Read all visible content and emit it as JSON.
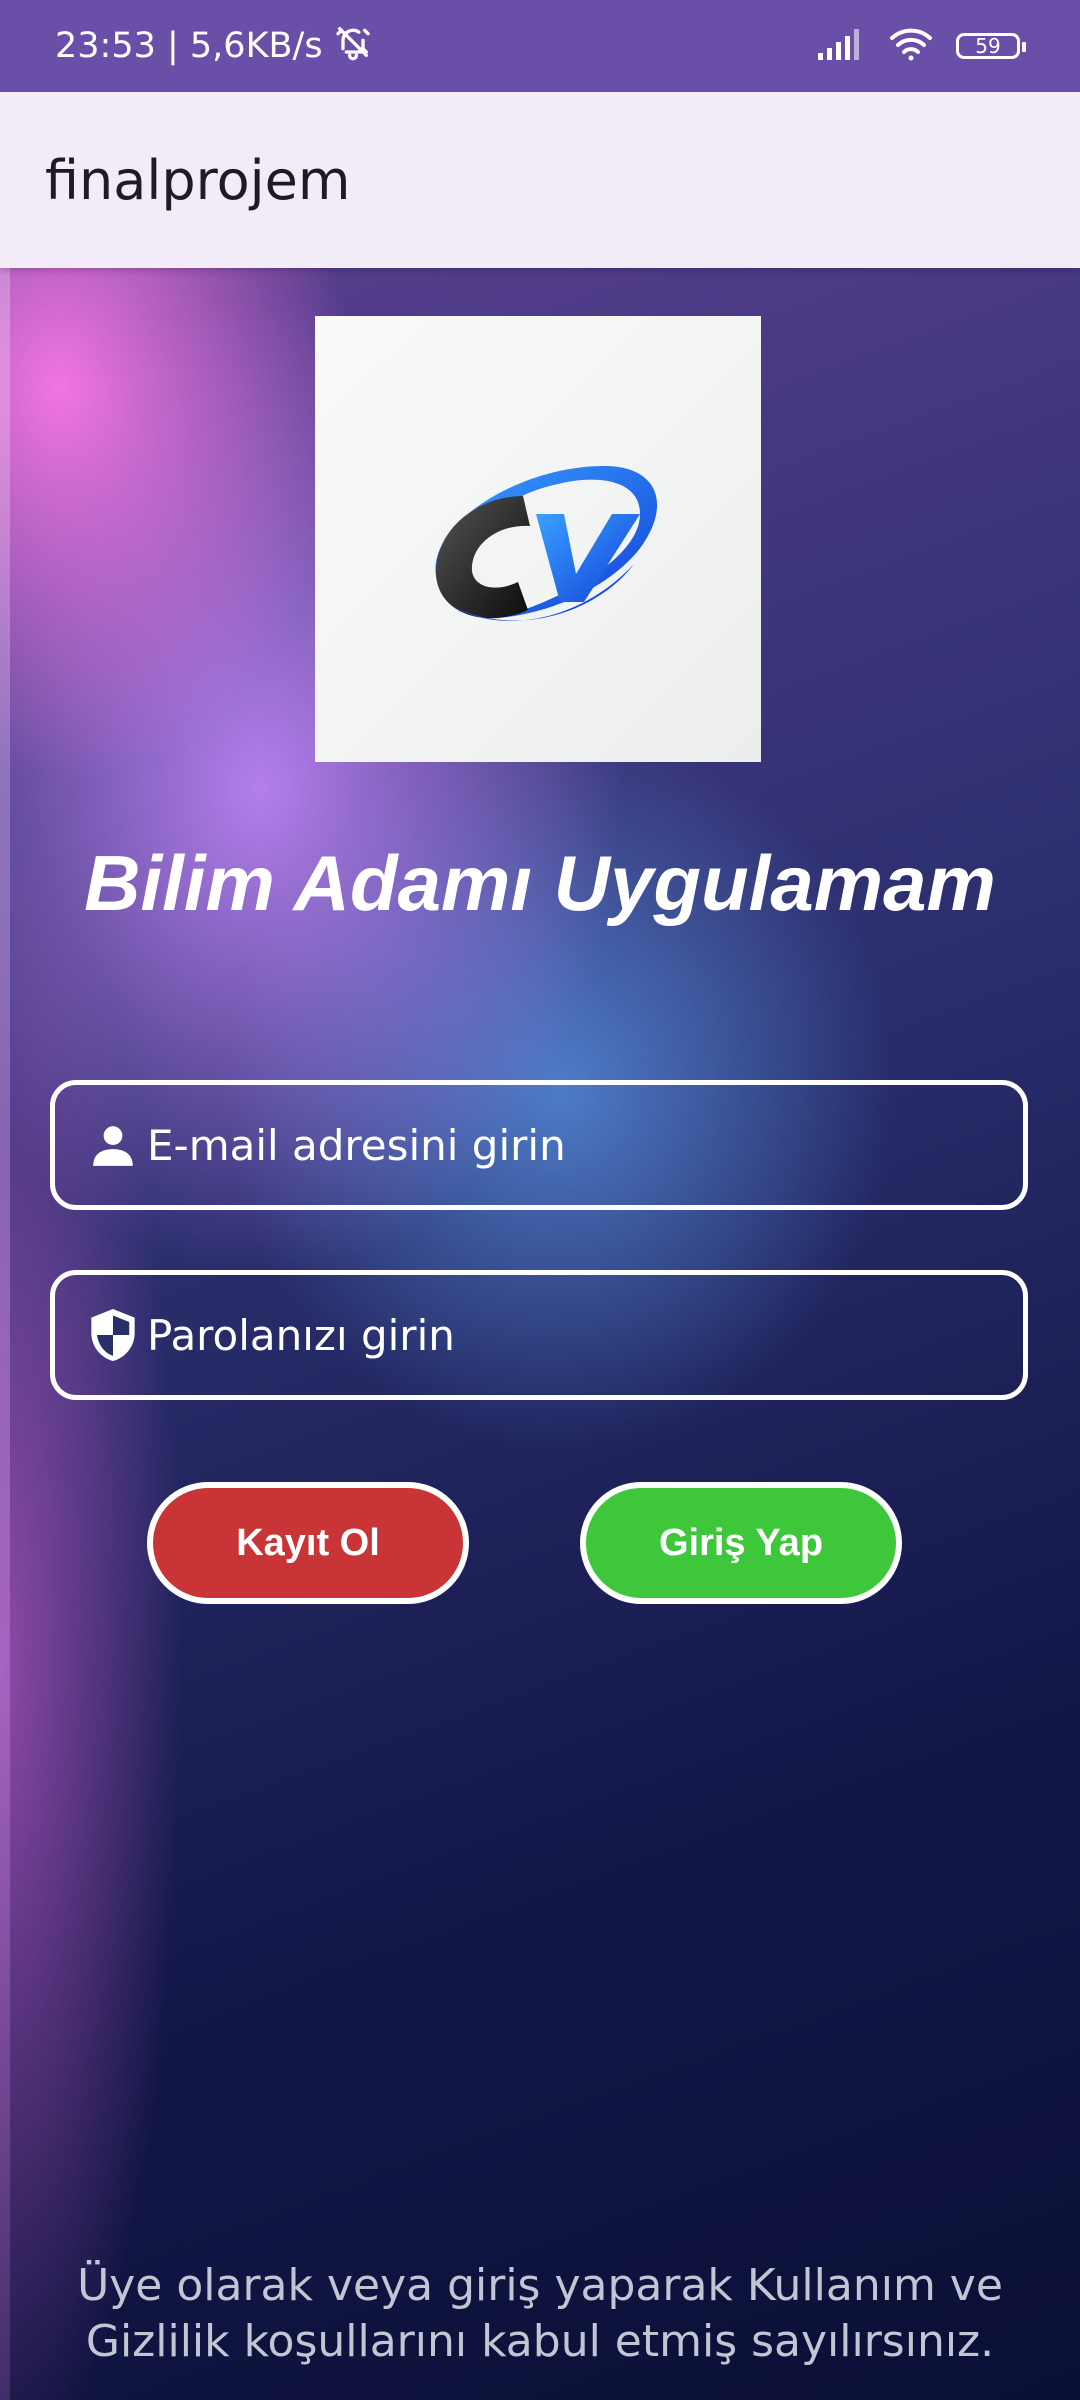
{
  "status_bar": {
    "time_speed": "23:53 | 5,6KB/s",
    "battery_level": "59",
    "icons": [
      "mute-alarm-icon",
      "signal-icon",
      "wifi-icon",
      "battery-icon"
    ]
  },
  "app_bar": {
    "title": "finalprojem",
    "background": "#f2ecf6"
  },
  "main": {
    "logo": "cv-logo-icon",
    "headline": "Bilim Adamı Uygulamam",
    "email_field": {
      "placeholder": "E-mail adresini girin",
      "value": "",
      "icon": "person-icon"
    },
    "password_field": {
      "placeholder": "Parolanızı girin",
      "value": "",
      "icon": "shield-icon"
    },
    "register_button": {
      "label": "Kayıt Ol",
      "color": "#c93436"
    },
    "login_button": {
      "label": "Giriş Yap",
      "color": "#3ec73a"
    },
    "footer_text": "Üye olarak veya giriş yaparak Kullanım ve Gizlilik koşullarını kabul etmiş sayılırsınız."
  },
  "colors": {
    "status_bar": "#6a4fa8",
    "text_on_dark": "#ffffff"
  }
}
